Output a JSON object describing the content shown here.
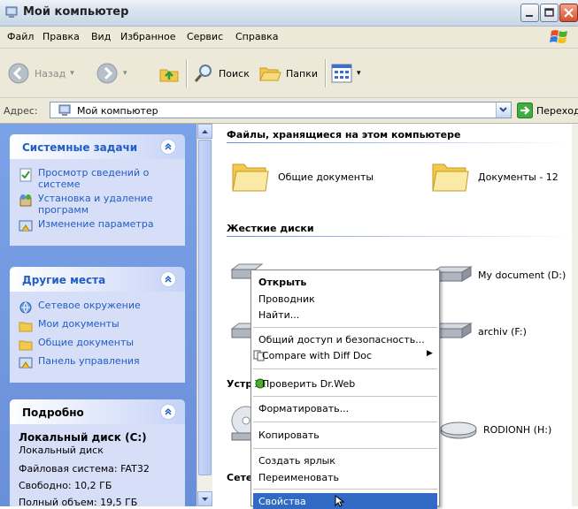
{
  "window": {
    "title": "Мой компьютер"
  },
  "menu": [
    "Файл",
    "Правка",
    "Вид",
    "Избранное",
    "Сервис",
    "Справка"
  ],
  "toolbar": {
    "back": "Назад",
    "search": "Поиск",
    "folders": "Папки"
  },
  "address": {
    "label": "Адрес:",
    "value": "Мой компьютер",
    "go": "Переход"
  },
  "tasks_panel": {
    "title": "Системные задачи",
    "items": [
      "Просмотр сведений о системе",
      "Установка и удаление программ",
      "Изменение параметра"
    ]
  },
  "places_panel": {
    "title": "Другие места",
    "items": [
      "Сетевое окружение",
      "Мои документы",
      "Общие документы",
      "Панель управления"
    ]
  },
  "details_panel": {
    "title": "Подробно",
    "name": "Локальный диск (C:)",
    "type": "Локальный диск",
    "fs": "Файловая система: FAT32",
    "free": "Свободно: 10,2 ГБ",
    "total": "Полный объем: 19,5 ГБ"
  },
  "sections": {
    "files": "Файлы, хранящиеся на этом компьютере",
    "drives": "Жесткие диски",
    "devices": "Устр",
    "network": "Сете"
  },
  "files": [
    "Общие документы",
    "Документы - 12"
  ],
  "drives": [
    "My document (D:)",
    "archiv (F:)"
  ],
  "devices": [
    "RODIONH (H:)"
  ],
  "context_menu": {
    "open": "Открыть",
    "explorer": "Проводник",
    "find": "Найти...",
    "sharing": "Общий доступ и безопасность...",
    "compare": "Compare with Diff Doc",
    "drweb": "Проверить Dr.Web",
    "format": "Форматировать...",
    "copy": "Копировать",
    "shortcut": "Создать ярлык",
    "rename": "Переименовать",
    "properties": "Свойства"
  },
  "colors": {
    "taskpane": "#6a8fd9",
    "link": "#215dc6",
    "highlight": "#316ac5"
  }
}
